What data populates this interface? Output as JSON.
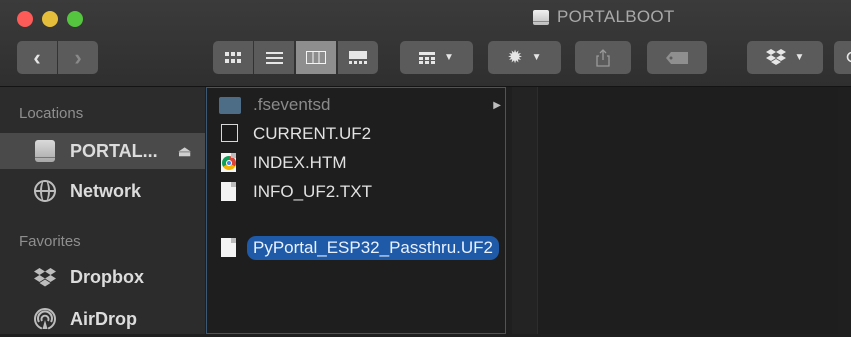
{
  "window": {
    "title": "PORTALBOOT"
  },
  "toolbar": {
    "back_icon": "chevron-left-icon",
    "forward_icon": "chevron-right-icon",
    "view_modes": [
      "icon-view-icon",
      "list-view-icon",
      "column-view-icon",
      "gallery-view-icon"
    ],
    "active_view": "column-view-icon",
    "group_icon": "grid-icon",
    "action_icon": "gear-icon",
    "share_icon": "share-icon",
    "tag_icon": "tag-icon",
    "dropbox_icon": "dropbox-icon"
  },
  "sidebar": {
    "locations_header": "Locations",
    "locations": [
      {
        "label": "PORTAL...",
        "icon": "drive-icon",
        "selected": true,
        "eject": "⏏"
      },
      {
        "label": "Network",
        "icon": "network-globe-icon"
      }
    ],
    "favorites_header": "Favorites",
    "favorites": [
      {
        "label": "Dropbox",
        "icon": "dropbox-icon"
      },
      {
        "label": "AirDrop",
        "icon": "airdrop-icon"
      }
    ]
  },
  "files": [
    {
      "name": ".fseventsd",
      "icon": "folder-icon",
      "hidden": true,
      "has_children": true
    },
    {
      "name": "CURRENT.UF2",
      "icon": "uf2-file-icon"
    },
    {
      "name": "INDEX.HTM",
      "icon": "chrome-html-icon"
    },
    {
      "name": "INFO_UF2.TXT",
      "icon": "text-file-icon"
    },
    {
      "name": "PyPortal_ESP32_Passthru.UF2",
      "icon": "document-icon",
      "selected": true
    }
  ],
  "colors": {
    "selection": "#1f5aa8",
    "background": "#1e1e1e"
  }
}
